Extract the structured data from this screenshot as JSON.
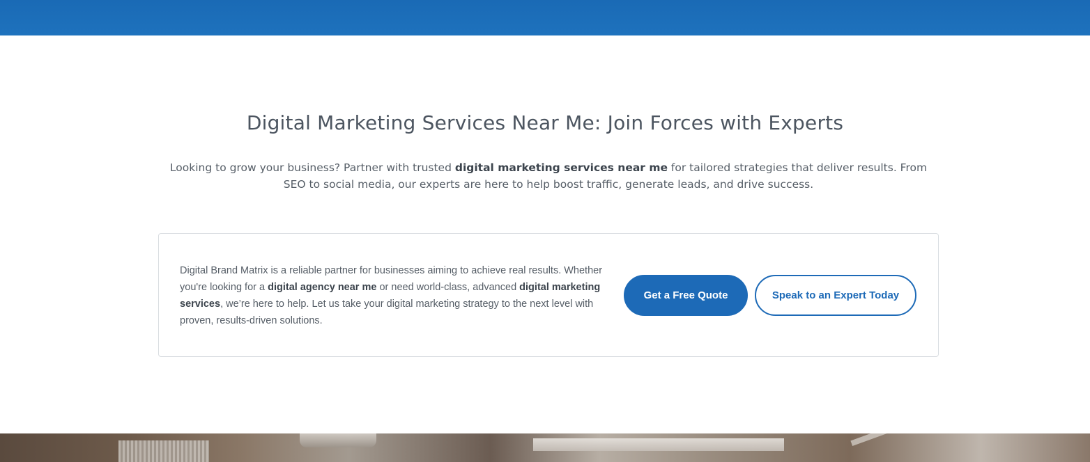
{
  "hero": {
    "title": "Digital Marketing Services Near Me: Join Forces with Experts",
    "intro": {
      "part1": "Looking to grow your business? Partner with trusted ",
      "bold1": "digital marketing services near me",
      "part2": " for tailored strategies that deliver results. From SEO to social media, our experts are here to help boost traffic, generate leads, and drive success."
    }
  },
  "card": {
    "text": {
      "part1": "Digital Brand Matrix is a reliable partner for businesses aiming to achieve real results. Whether you're looking for a ",
      "bold1": "digital agency near me",
      "part2": " or need world-class, advanced ",
      "bold2": "digital marketing services",
      "part3": ", we’re here to help. Let us take your digital marketing strategy to the next level with proven, results-driven solutions."
    },
    "primary_button": "Get a Free Quote",
    "secondary_button": "Speak to an Expert Today"
  },
  "colors": {
    "brand_blue": "#1d6ab7",
    "heading": "#4c5560",
    "body_text": "#555d66"
  }
}
